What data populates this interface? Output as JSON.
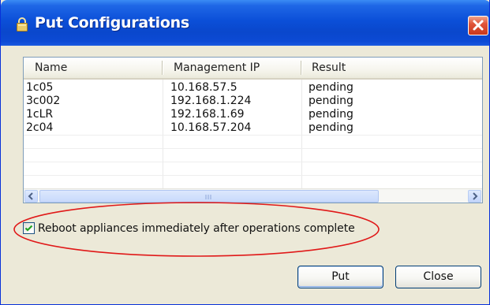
{
  "window": {
    "title": "Put Configurations",
    "title_icon": "lock-icon",
    "close_icon": "close-icon"
  },
  "table": {
    "columns": [
      "Name",
      "Management IP",
      "Result"
    ],
    "rows": [
      [
        "1c05",
        "10.168.57.5",
        "pending"
      ],
      [
        "3c002",
        "192.168.1.224",
        "pending"
      ],
      [
        "1cLR",
        "192.168.1.69",
        "pending"
      ],
      [
        "2c04",
        "10.168.57.204",
        "pending"
      ]
    ]
  },
  "reboot_option": {
    "label": "Reboot appliances immediately after operations complete",
    "checked": true
  },
  "buttons": {
    "put": "Put",
    "close": "Close"
  },
  "colors": {
    "titlebar": "#0b4fd8",
    "dialog_background": "#ece9d8",
    "highlight_ellipse": "#e01818",
    "close_button": "#d8472a",
    "checkmark": "#21a121"
  }
}
